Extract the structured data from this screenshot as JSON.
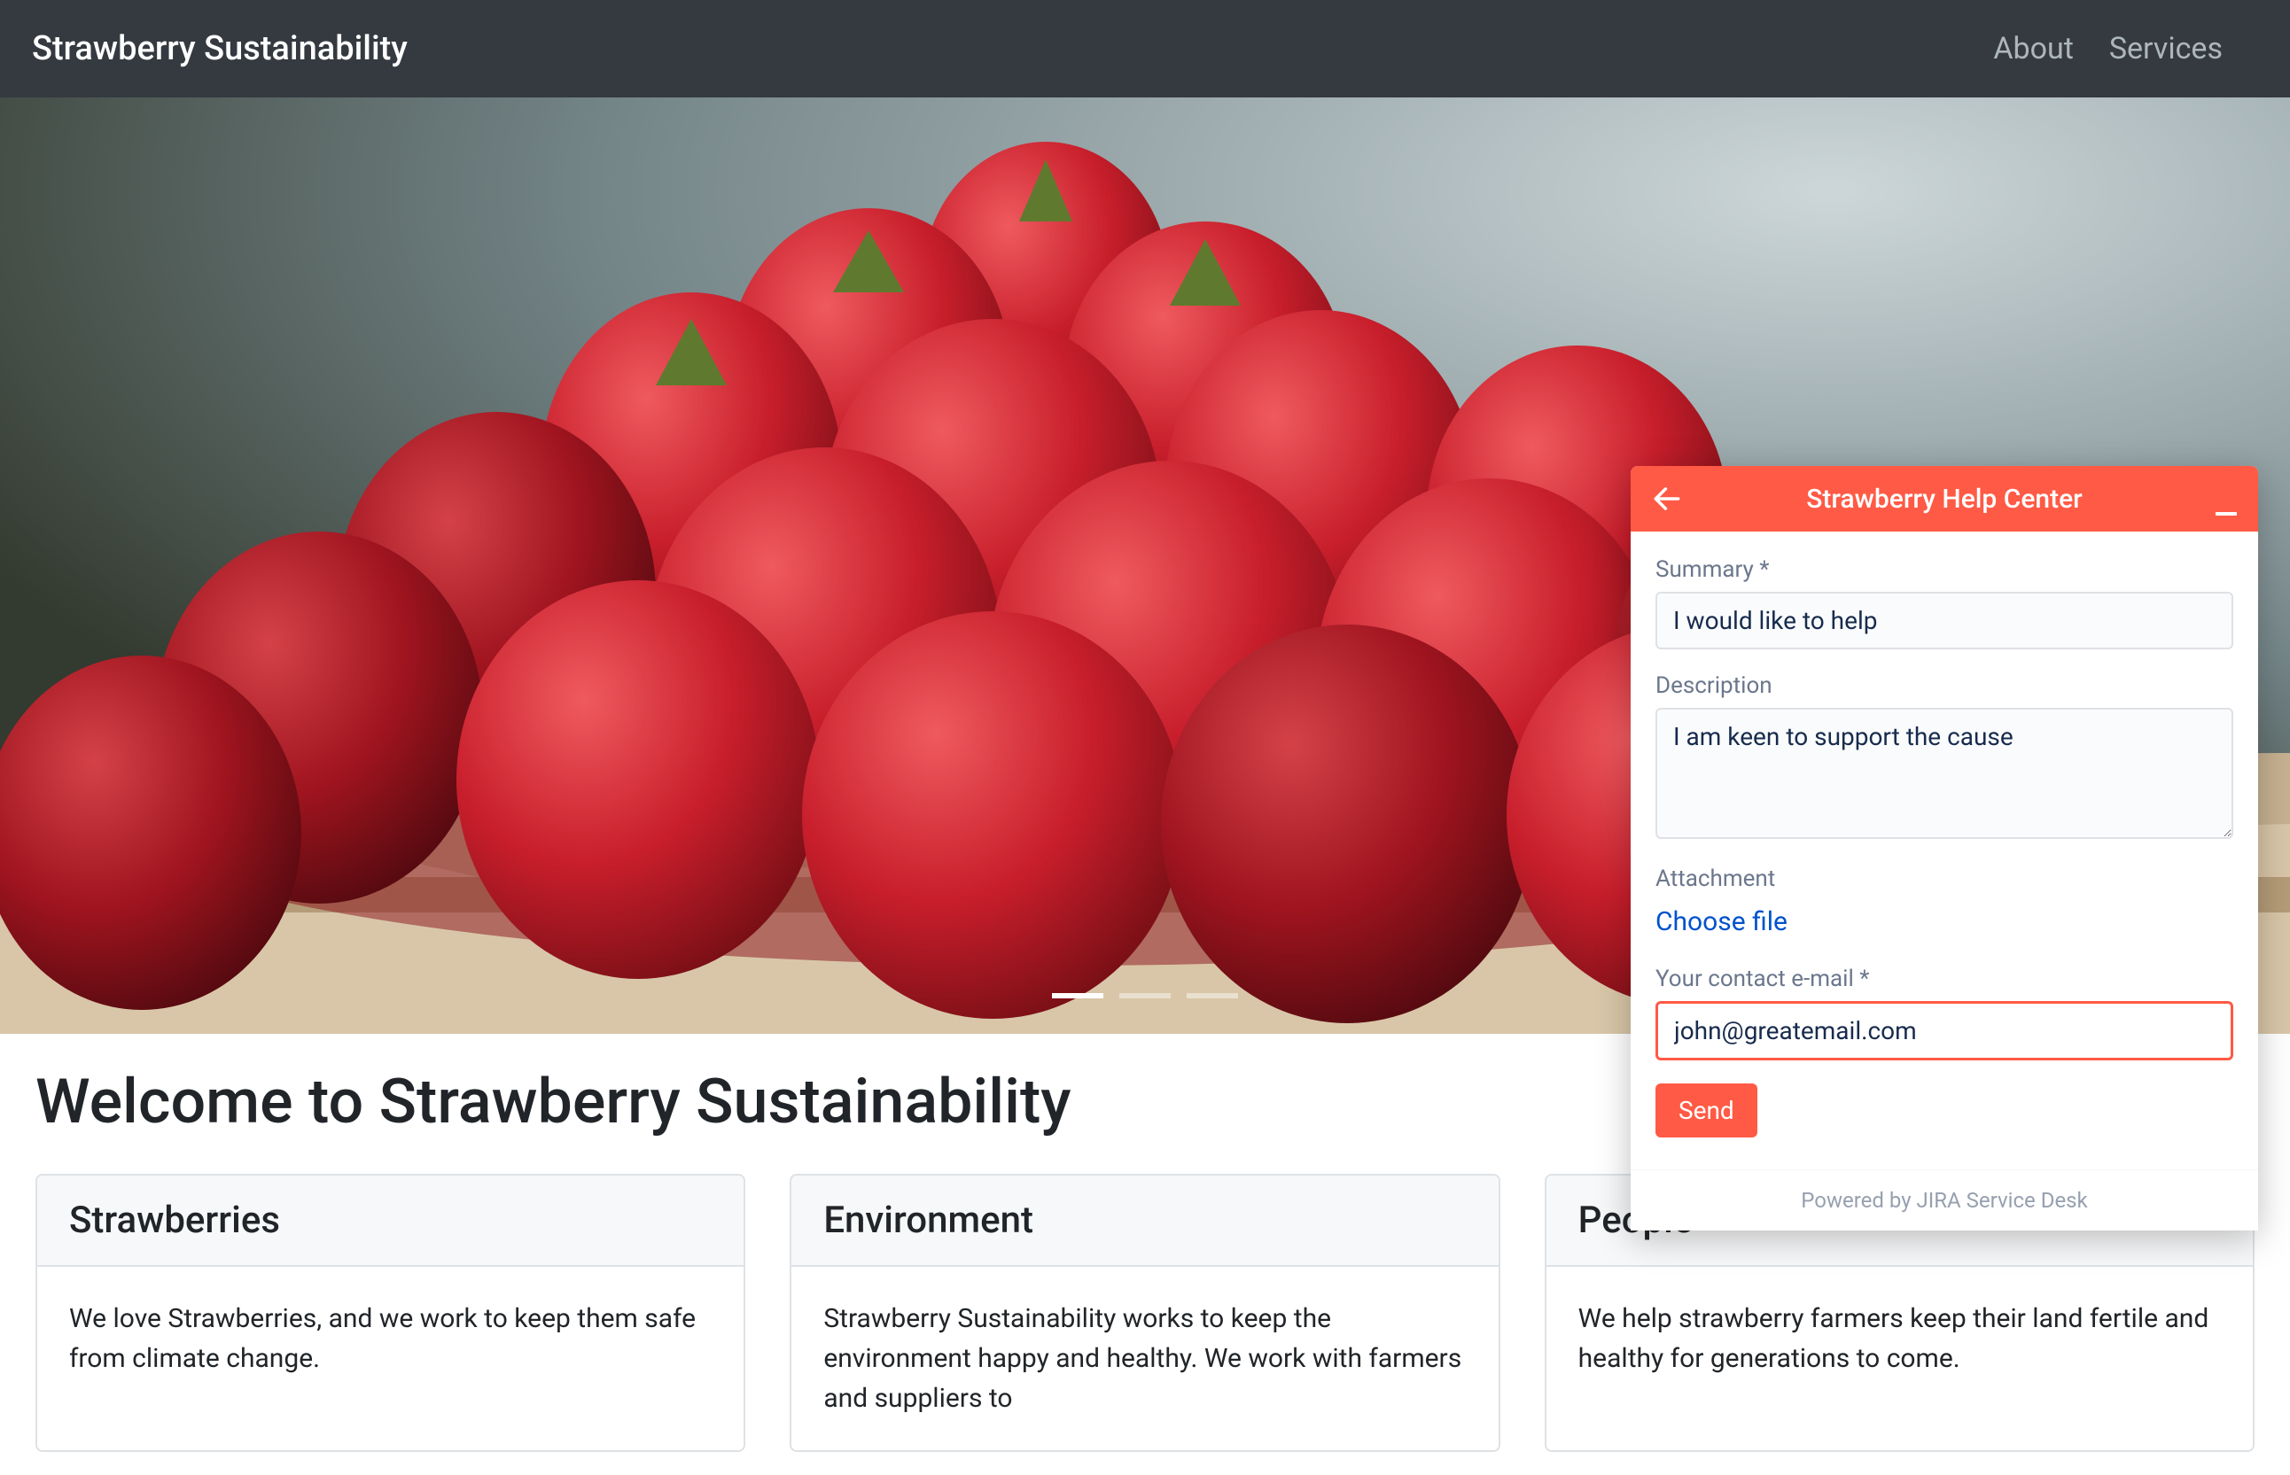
{
  "nav": {
    "brand": "Strawberry Sustainability",
    "links": [
      {
        "label": "About"
      },
      {
        "label": "Services"
      }
    ]
  },
  "hero": {
    "active_slide": 0,
    "slide_count": 3
  },
  "page": {
    "title": "Welcome to Strawberry Sustainability",
    "cards": [
      {
        "title": "Strawberries",
        "body": "We love Strawberries, and we work to keep them safe from climate change."
      },
      {
        "title": "Environment",
        "body": "Strawberry Sustainability works to keep the environment happy and healthy. We work with farmers and suppliers to"
      },
      {
        "title": "People",
        "body": "We help strawberry farmers keep their land fertile and healthy for generations to come."
      }
    ]
  },
  "widget": {
    "title": "Strawberry Help Center",
    "summary_label": "Summary *",
    "summary_value": "I would like to help",
    "description_label": "Description",
    "description_value": "I am keen to support the cause",
    "attachment_label": "Attachment",
    "choose_file": "Choose file",
    "email_label": "Your contact e-mail *",
    "email_value": "john@greatemail.com",
    "send": "Send",
    "footer": "Powered by JIRA Service Desk"
  }
}
